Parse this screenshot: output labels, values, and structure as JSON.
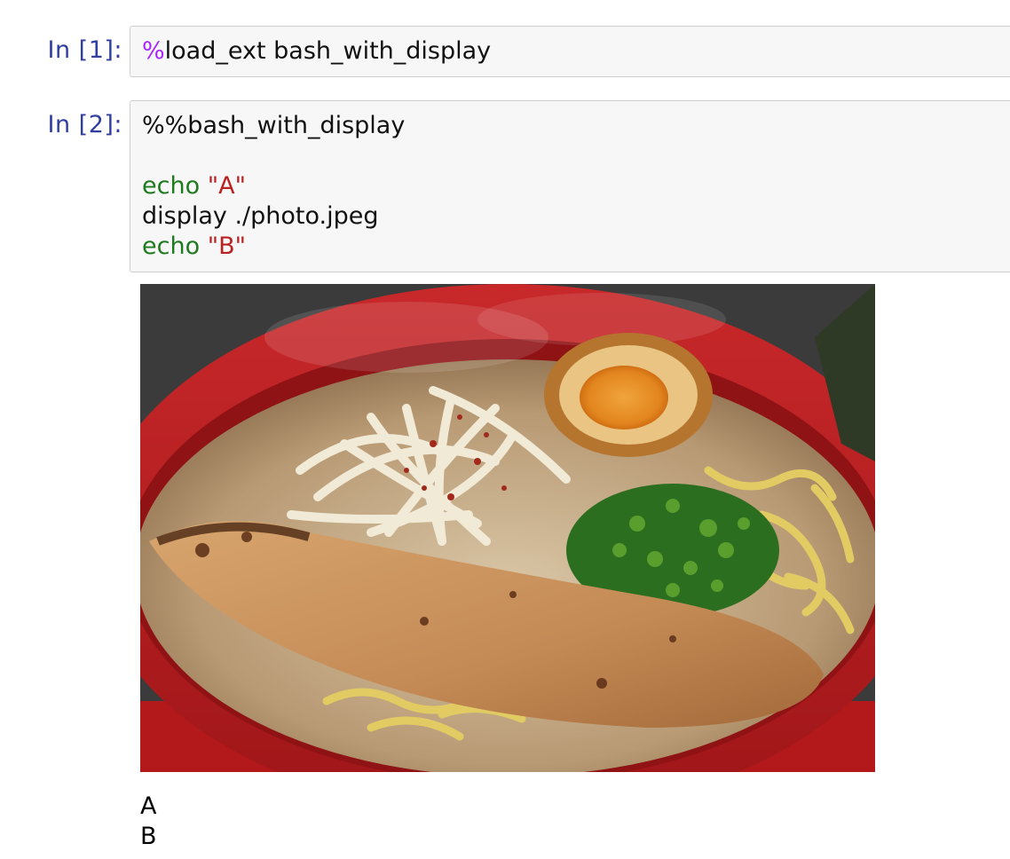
{
  "cells": [
    {
      "prompt": "In [1]:",
      "lines": [
        {
          "magic": "%",
          "rest": "load_ext bash_with_display"
        }
      ]
    },
    {
      "prompt": "In [2]:",
      "lines": [
        {
          "text": "%%bash_with_display"
        },
        {
          "keyword": "echo",
          "space": " ",
          "string": "\"A\""
        },
        {
          "text": "display ./photo.jpeg"
        },
        {
          "keyword": "echo",
          "space": " ",
          "string": "\"B\""
        }
      ]
    }
  ],
  "output": {
    "stdout": [
      "A",
      "B"
    ]
  },
  "colors": {
    "prompt": "#303f9f",
    "magic": "#aa22ff",
    "builtin": "#1f7a1f",
    "string": "#ba2121",
    "code_bg": "#f7f7f7",
    "code_border": "#cfcfcf"
  }
}
